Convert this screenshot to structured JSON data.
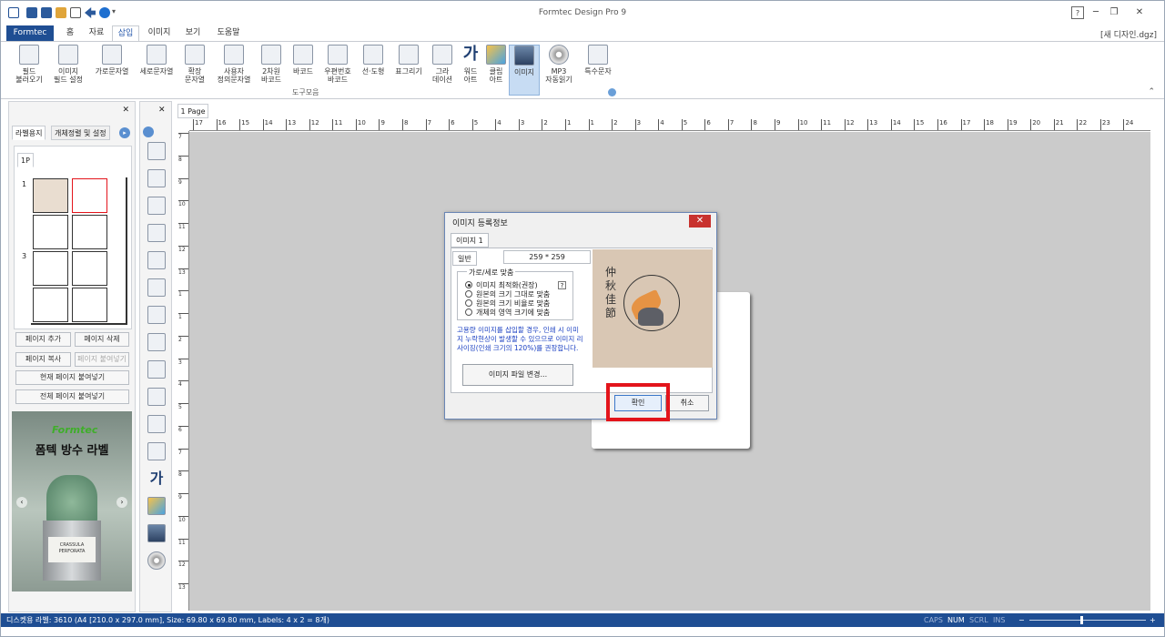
{
  "app": {
    "title": "Formtec Design Pro 9",
    "document_name": "[새 디자인.dgz]"
  },
  "ribbon": {
    "tabs": [
      "Formtec",
      "홈",
      "자료",
      "삽입",
      "이미지",
      "보기",
      "도움말"
    ],
    "active_tab": "삽입",
    "buttons": [
      {
        "label": "필드\n불러오기",
        "icon": "field-load-icon"
      },
      {
        "label": "이미지\n필드 설정",
        "icon": "image-field-icon"
      },
      {
        "label": "가로문자열",
        "icon": "horizontal-text-icon"
      },
      {
        "label": "세로문자열",
        "icon": "vertical-text-icon"
      },
      {
        "label": "확장\n문자열",
        "icon": "extended-text-icon"
      },
      {
        "label": "사용자\n정의문자열",
        "icon": "custom-text-icon"
      },
      {
        "label": "2차원\n바코드",
        "icon": "qr-code-icon"
      },
      {
        "label": "바코드",
        "icon": "barcode-icon"
      },
      {
        "label": "우편번호\n바코드",
        "icon": "postal-barcode-icon"
      },
      {
        "label": "선·도형",
        "icon": "shape-icon"
      },
      {
        "label": "표그리기",
        "icon": "table-icon"
      },
      {
        "label": "그라\n데이션",
        "icon": "gradient-icon"
      },
      {
        "label": "워드\n아트",
        "icon": "word-art-icon"
      },
      {
        "label": "클립\n아트",
        "icon": "clip-art-icon"
      },
      {
        "label": "이미지",
        "icon": "image-icon"
      },
      {
        "label": "MP3\n자동읽기",
        "icon": "mp3-icon"
      },
      {
        "label": "특수문자",
        "icon": "special-char-icon"
      }
    ],
    "group_label": "도구모음"
  },
  "left_panel": {
    "tabs": [
      "라벨용지",
      "개체정렬 및 설정"
    ],
    "page_tab": "1P",
    "row_numbers": [
      "1",
      "3"
    ],
    "buttons": {
      "add_page": "페이지 추가",
      "delete_page": "페이지 삭제",
      "copy_page": "페이지 복사",
      "paste_page": "페이지 붙여넣기",
      "paste_current": "현재 페이지 붙여넣기",
      "paste_all": "전체 페이지 붙여넣기"
    },
    "ad": {
      "brand": "Formtec",
      "headline": "폼텍 방수 라벨",
      "pot_text": "CRASSULA PERFORATA"
    }
  },
  "canvas": {
    "page_tab": "1 Page",
    "ruler_ticks": [
      "17",
      "16",
      "15",
      "14",
      "13",
      "12",
      "11",
      "10",
      "9",
      "8",
      "7",
      "6",
      "5",
      "4",
      "3",
      "2",
      "1",
      "1",
      "2",
      "3",
      "4",
      "5",
      "6",
      "7",
      "8",
      "9",
      "10",
      "11",
      "12",
      "13",
      "14",
      "15",
      "16",
      "17",
      "18",
      "19",
      "20",
      "21",
      "22",
      "23",
      "24"
    ],
    "vruler_ticks": [
      "7",
      "8",
      "9",
      "10",
      "11",
      "12",
      "13",
      "1",
      "1",
      "2",
      "3",
      "4",
      "5",
      "6",
      "7",
      "8",
      "9",
      "10",
      "11",
      "12",
      "13"
    ]
  },
  "dialog": {
    "title": "이미지 등록정보",
    "close": "✕",
    "image_tab": "이미지 1",
    "general_tab": "일반",
    "size": "259 * 259",
    "fit_group": "가로/세로 맞춤",
    "help": "?",
    "options": [
      {
        "label": "이미지 최적화(권장)",
        "checked": true
      },
      {
        "label": "원본의 크기 그대로 맞춤",
        "checked": false
      },
      {
        "label": "원본의 크기 비율로 맞춤",
        "checked": false
      },
      {
        "label": "개체의 영역 크기에 맞춤",
        "checked": false
      }
    ],
    "warning": "고용량 이미지를 삽입할 경우, 인쇄 시 이미지 누락현상이 발생할 수 있으므로 이미지 리사이징(인쇄 크기의 120%)를 권장합니다.",
    "change_file": "이미지 파일 변경...",
    "ok": "확인",
    "cancel": "취소",
    "preview_text": "仲秋佳節"
  },
  "statusbar": {
    "info": "디스켓용 라벨: 3610 (A4 [210.0 x 297.0 mm], Size: 69.80 x 69.80 mm,  Labels: 4 x 2 = 8개)",
    "caps": "CAPS",
    "num": "NUM",
    "scrl": "SCRL",
    "ins": "INS",
    "zoom_minus": "−",
    "zoom_plus": "+"
  },
  "colors": {
    "accent": "#1f4e93",
    "highlight": "#e3141b",
    "dialog_close": "#c8322e"
  }
}
